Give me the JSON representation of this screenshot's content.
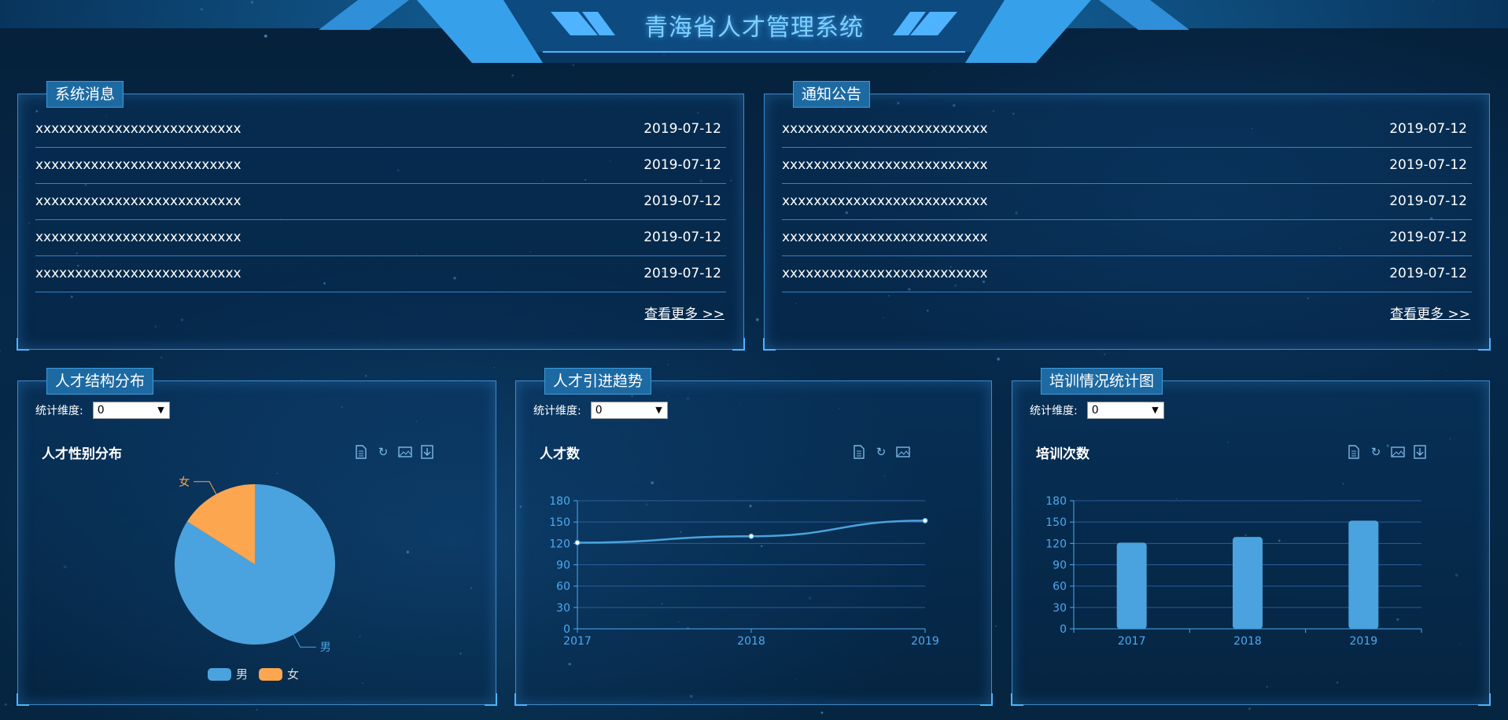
{
  "header": {
    "title": "青海省人才管理系统"
  },
  "messages": {
    "title": "系统消息",
    "items": [
      {
        "text": "xxxxxxxxxxxxxxxxxxxxxxxxxx",
        "date": "2019-07-12"
      },
      {
        "text": "xxxxxxxxxxxxxxxxxxxxxxxxxx",
        "date": "2019-07-12"
      },
      {
        "text": "xxxxxxxxxxxxxxxxxxxxxxxxxx",
        "date": "2019-07-12"
      },
      {
        "text": "xxxxxxxxxxxxxxxxxxxxxxxxxx",
        "date": "2019-07-12"
      },
      {
        "text": "xxxxxxxxxxxxxxxxxxxxxxxxxx",
        "date": "2019-07-12"
      }
    ],
    "more": "查看更多 >>"
  },
  "notices": {
    "title": "通知公告",
    "items": [
      {
        "text": "xxxxxxxxxxxxxxxxxxxxxxxxxx",
        "date": "2019-07-12"
      },
      {
        "text": "xxxxxxxxxxxxxxxxxxxxxxxxxx",
        "date": "2019-07-12"
      },
      {
        "text": "xxxxxxxxxxxxxxxxxxxxxxxxxx",
        "date": "2019-07-12"
      },
      {
        "text": "xxxxxxxxxxxxxxxxxxxxxxxxxx",
        "date": "2019-07-12"
      },
      {
        "text": "xxxxxxxxxxxxxxxxxxxxxxxxxx",
        "date": "2019-07-12"
      }
    ],
    "more": "查看更多 >>"
  },
  "panels": {
    "structure": {
      "title": "人才结构分布",
      "dim_label": "统计维度:",
      "dim_value": "0",
      "icons": [
        "data-view-icon",
        "refresh-icon",
        "save-image-icon",
        "download-icon"
      ]
    },
    "trend": {
      "title": "人才引进趋势",
      "dim_label": "统计维度:",
      "dim_value": "0",
      "icons": [
        "data-view-icon",
        "refresh-icon",
        "save-image-icon"
      ]
    },
    "training": {
      "title": "培训情况统计图",
      "dim_label": "统计维度:",
      "dim_value": "0",
      "icons": [
        "data-view-icon",
        "refresh-icon",
        "save-image-icon",
        "download-icon"
      ]
    }
  },
  "colors": {
    "primary": "#4aa3de",
    "secondary": "#fca64f",
    "axis": "#4da9f0"
  },
  "chart_data": [
    {
      "type": "pie",
      "title": "人才性别分布",
      "categories": [
        "男",
        "女"
      ],
      "values": [
        84,
        16
      ],
      "colors": [
        "#4aa3de",
        "#fca64f"
      ],
      "legend": "bottom"
    },
    {
      "type": "line",
      "title": "人才数",
      "categories": [
        "2017",
        "2018",
        "2019"
      ],
      "values": [
        121,
        130,
        152
      ],
      "ylim": [
        0,
        180
      ],
      "yticks": [
        0,
        30,
        60,
        90,
        120,
        150,
        180
      ],
      "grid": true
    },
    {
      "type": "bar",
      "title": "培训次数",
      "categories": [
        "2017",
        "2018",
        "2019"
      ],
      "values": [
        121,
        129,
        152
      ],
      "ylim": [
        0,
        180
      ],
      "yticks": [
        0,
        30,
        60,
        90,
        120,
        150,
        180
      ],
      "grid": true
    }
  ]
}
